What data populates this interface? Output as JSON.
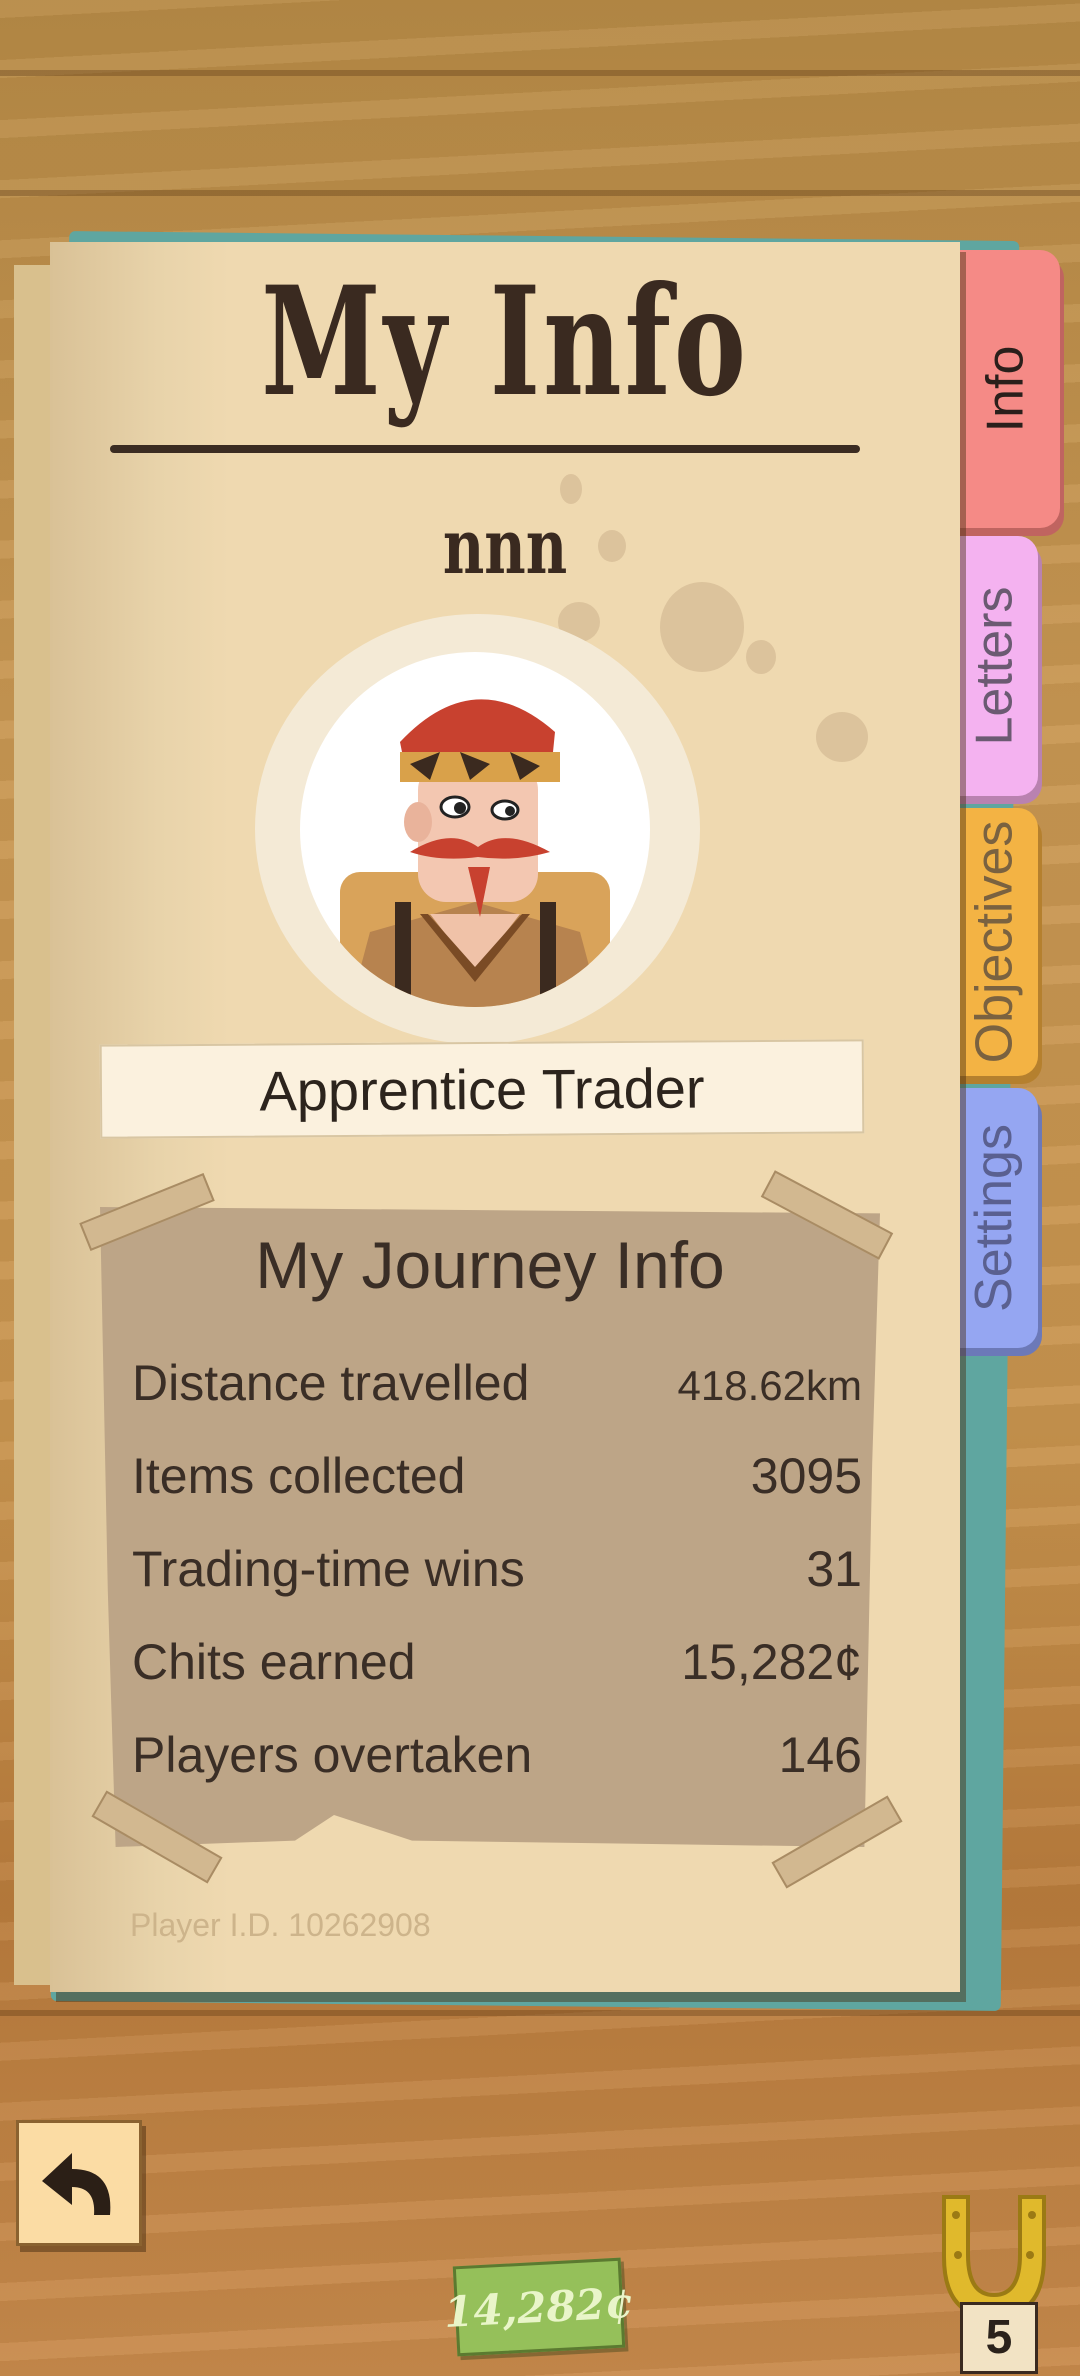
{
  "page": {
    "title": "My Info",
    "player_name": "nnn",
    "rank": "Apprentice Trader",
    "player_id": "Player I.D. 10262908"
  },
  "journey": {
    "title": "My Journey Info",
    "stats": [
      {
        "label": "Distance travelled",
        "value": "418.62km"
      },
      {
        "label": "Items collected",
        "value": "3095"
      },
      {
        "label": "Trading-time wins",
        "value": "31"
      },
      {
        "label": "Chits earned",
        "value": "15,282¢"
      },
      {
        "label": "Players overtaken",
        "value": "146"
      }
    ]
  },
  "tabs": [
    {
      "label": "Info",
      "color": "#f58a86",
      "active": true
    },
    {
      "label": "Letters",
      "color": "#f4b2f0",
      "active": false
    },
    {
      "label": "Objectives",
      "color": "#f3b344",
      "active": false
    },
    {
      "label": "Settings",
      "color": "#95a6f2",
      "active": false
    }
  ],
  "footer": {
    "back_icon": "back-arrow-icon",
    "currency": "14,282¢",
    "horseshoe_icon": "horseshoe-icon",
    "horseshoe_count": "5"
  },
  "colors": {
    "page": "#efd9b0",
    "ink": "#3a2a20",
    "journey_panel": "#bda587",
    "currency_green": "#95c05a"
  }
}
